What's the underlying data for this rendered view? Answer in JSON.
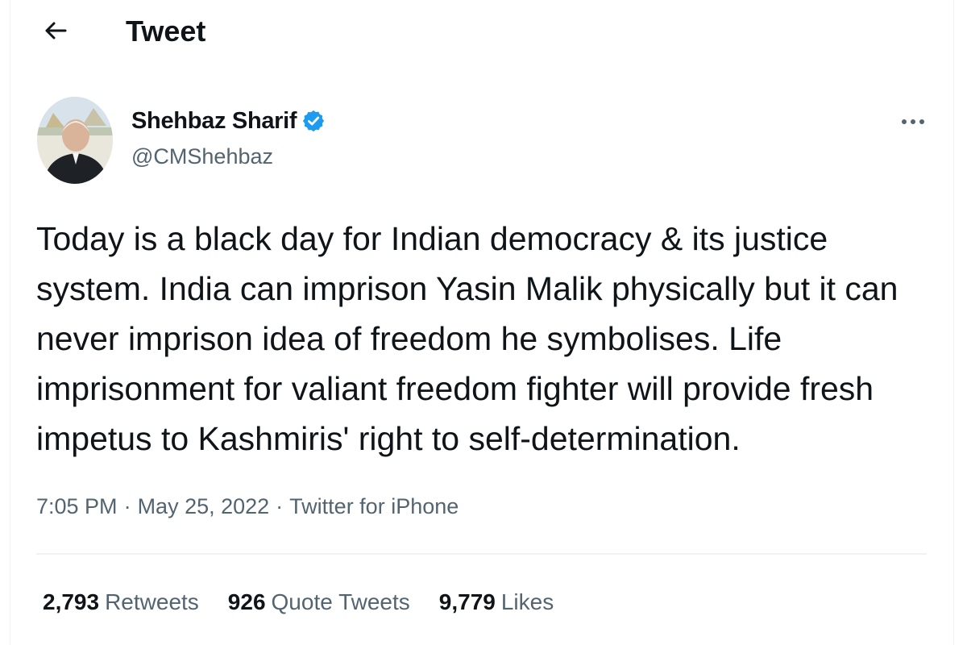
{
  "header": {
    "back_icon": "arrow-left-icon",
    "title": "Tweet"
  },
  "author": {
    "display_name": "Shehbaz Sharif",
    "verified_icon": "verified-badge-icon",
    "verified_color": "#1d9bf0",
    "handle": "@CMShehbaz",
    "more_icon": "more-horizontal-icon"
  },
  "tweet": {
    "text": "Today is a black day for Indian democracy & its justice system. India can imprison Yasin Malik physically but it can never imprison idea of freedom he symbolises. Life imprisonment for valiant freedom fighter will provide fresh impetus to Kashmiris' right to self-determination.",
    "time": "7:05 PM",
    "date": "May 25, 2022",
    "source": "Twitter for iPhone",
    "separator": "·"
  },
  "stats": {
    "retweets_count": "2,793",
    "retweets_label": "Retweets",
    "quotes_count": "926",
    "quotes_label": "Quote Tweets",
    "likes_count": "9,779",
    "likes_label": "Likes"
  },
  "colors": {
    "text_primary": "#0f1419",
    "text_secondary": "#536471",
    "divider": "#eff3f4"
  }
}
